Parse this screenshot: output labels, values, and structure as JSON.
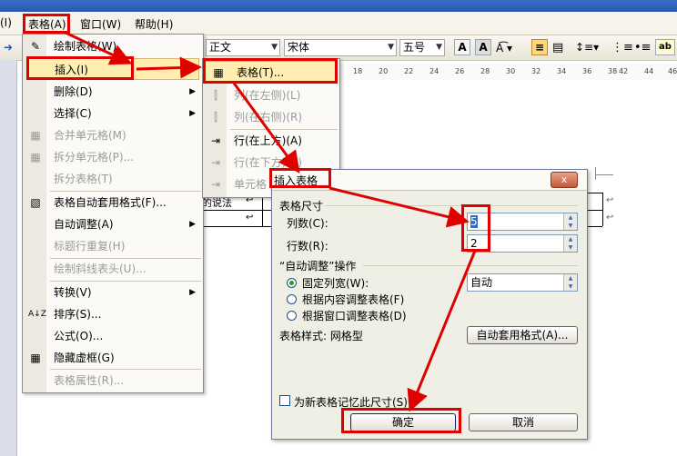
{
  "menubar": {
    "partial_left": "(I)",
    "table": "表格(A)",
    "window": "窗口(W)",
    "help": "帮助(H)"
  },
  "toolbar": {
    "style_value": "正文",
    "font_value": "宋体",
    "size_value": "五号",
    "bold_label": "A",
    "highlight_label": "A",
    "ab_label": "ab"
  },
  "ruler": [
    "18",
    "20",
    "22",
    "24",
    "26",
    "28",
    "30",
    "32",
    "34",
    "36",
    "38",
    "42",
    "44",
    "46"
  ],
  "doc": {
    "cell_text": "的说法",
    "marks": [
      "↩",
      "↩",
      "↩",
      "↩"
    ]
  },
  "table_menu": {
    "items": [
      {
        "label": "绘制表格(W)",
        "disabled": false,
        "icon": "pencil-table-icon"
      },
      {
        "label": "插入(I)",
        "disabled": false,
        "submenu": true
      },
      {
        "label": "删除(D)",
        "disabled": false,
        "submenu": true
      },
      {
        "label": "选择(C)",
        "disabled": false,
        "submenu": true
      },
      {
        "label": "合并单元格(M)",
        "disabled": true,
        "icon": "merge-cells-icon"
      },
      {
        "label": "拆分单元格(P)...",
        "disabled": true,
        "icon": "split-cells-icon"
      },
      {
        "label": "拆分表格(T)",
        "disabled": true
      },
      {
        "label": "表格自动套用格式(F)...",
        "disabled": false,
        "icon": "autoformat-icon"
      },
      {
        "label": "自动调整(A)",
        "disabled": false,
        "submenu": true
      },
      {
        "label": "标题行重复(H)",
        "disabled": true
      },
      {
        "label": "绘制斜线表头(U)...",
        "disabled": true
      },
      {
        "label": "转换(V)",
        "disabled": false,
        "submenu": true
      },
      {
        "label": "排序(S)...",
        "disabled": false,
        "icon": "sort-az-icon"
      },
      {
        "label": "公式(O)...",
        "disabled": false
      },
      {
        "label": "隐藏虚框(G)",
        "disabled": false,
        "icon": "gridlines-icon"
      },
      {
        "label": "表格属性(R)...",
        "disabled": true
      }
    ]
  },
  "insert_submenu": {
    "items": [
      {
        "label": "表格(T)...",
        "disabled": false
      },
      {
        "label": "列(在左侧)(L)",
        "disabled": true
      },
      {
        "label": "列(在右侧)(R)",
        "disabled": true
      },
      {
        "label": "行(在上方)(A)",
        "disabled": false
      },
      {
        "label": "行(在下方)(B)",
        "disabled": true
      },
      {
        "label": "单元格",
        "disabled": true
      }
    ]
  },
  "dialog": {
    "title": "插入表格",
    "close_label": "x",
    "size_group": "表格尺寸",
    "cols_label": "列数(C):",
    "cols_value": "5",
    "rows_label": "行数(R):",
    "rows_value": "2",
    "autofit_group": "“自动调整”操作",
    "fixed_width_label": "固定列宽(W):",
    "fixed_width_value": "自动",
    "fit_content_label": "根据内容调整表格(F)",
    "fit_window_label": "根据窗口调整表格(D)",
    "style_label": "表格样式: 网格型",
    "autoformat_button": "自动套用格式(A)...",
    "remember_label": "为新表格记忆此尺寸(S)",
    "ok_button": "确定",
    "cancel_button": "取消"
  },
  "colors": {
    "annotation_red": "#e00000",
    "menu_highlight": "#ffeeb0",
    "title_blue": "#2a58b0"
  }
}
